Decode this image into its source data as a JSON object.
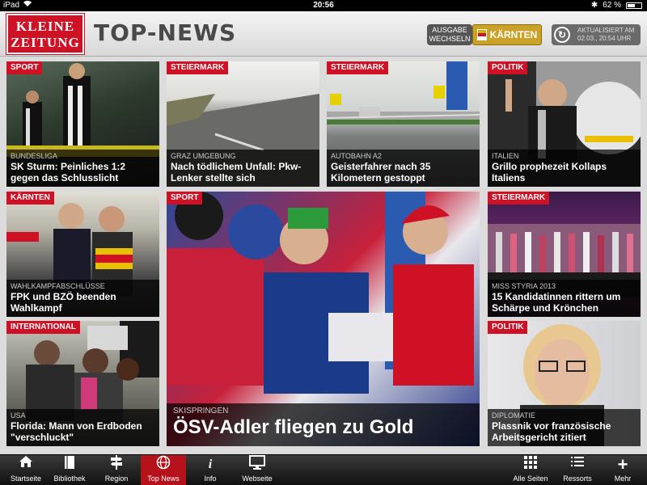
{
  "status": {
    "device": "iPad",
    "time": "20:56",
    "battery_label": "62 %",
    "battery_level": 0.62
  },
  "header": {
    "logo_line1": "KLEINE",
    "logo_line2": "ZEITUNG",
    "title": "TOP-NEWS",
    "ausgabe_line1": "AUSGABE",
    "ausgabe_line2": "WECHSELN",
    "edition": "KÄRNTEN",
    "updated_line1": "AKTUALISIERT AM",
    "updated_line2": "02.03., 20:54 UHR"
  },
  "tiles": [
    {
      "tag": "SPORT",
      "kicker": "BUNDESLIGA",
      "headline": "SK Sturm: Peinliches 1:2 gegen das Schlusslicht"
    },
    {
      "tag": "STEIERMARK",
      "kicker": "GRAZ UMGEBUNG",
      "headline": "Nach tödlichem Unfall: Pkw-Lenker stellte sich"
    },
    {
      "tag": "STEIERMARK",
      "kicker": "AUTOBAHN A2",
      "headline": "Geisterfahrer nach 35 Kilometern gestoppt"
    },
    {
      "tag": "POLITIK",
      "kicker": "ITALIEN",
      "headline": "Grillo prophezeit Kollaps Italiens"
    },
    {
      "tag": "KÄRNTEN",
      "kicker": "WAHLKAMPFABSCHLÜSSE",
      "headline": "FPK und BZÖ beenden Wahlkampf"
    },
    {
      "tag": "SPORT",
      "kicker": "SKISPRINGEN",
      "headline": "ÖSV-Adler fliegen zu Gold"
    },
    {
      "tag": "STEIERMARK",
      "kicker": "MISS STYRIA 2013",
      "headline": "15 Kandidatinnen rittern um Schärpe und Krönchen"
    },
    {
      "tag": "INTERNATIONAL",
      "kicker": "USA",
      "headline": "Florida: Mann von Erdboden \"verschluckt\""
    },
    {
      "tag": "POLITIK",
      "kicker": "DIPLOMATIE",
      "headline": "Plassnik vor französische Arbeitsgericht zitiert"
    }
  ],
  "tabbar": {
    "items": [
      {
        "label": "Startseite",
        "icon": "home-icon"
      },
      {
        "label": "Bibliothek",
        "icon": "book-icon"
      },
      {
        "label": "Region",
        "icon": "signpost-icon"
      },
      {
        "label": "Top News",
        "icon": "globe-icon",
        "active": true
      },
      {
        "label": "Info",
        "icon": "info-icon"
      },
      {
        "label": "Webseite",
        "icon": "monitor-icon"
      },
      {
        "label": "Alle Seiten",
        "icon": "grid-icon"
      },
      {
        "label": "Ressorts",
        "icon": "list-icon"
      },
      {
        "label": "Mehr",
        "icon": "plus-icon"
      }
    ]
  },
  "colors": {
    "brand_red": "#cf1126",
    "edition_gold": "#c9a227",
    "active_tab": "#b5121b"
  }
}
